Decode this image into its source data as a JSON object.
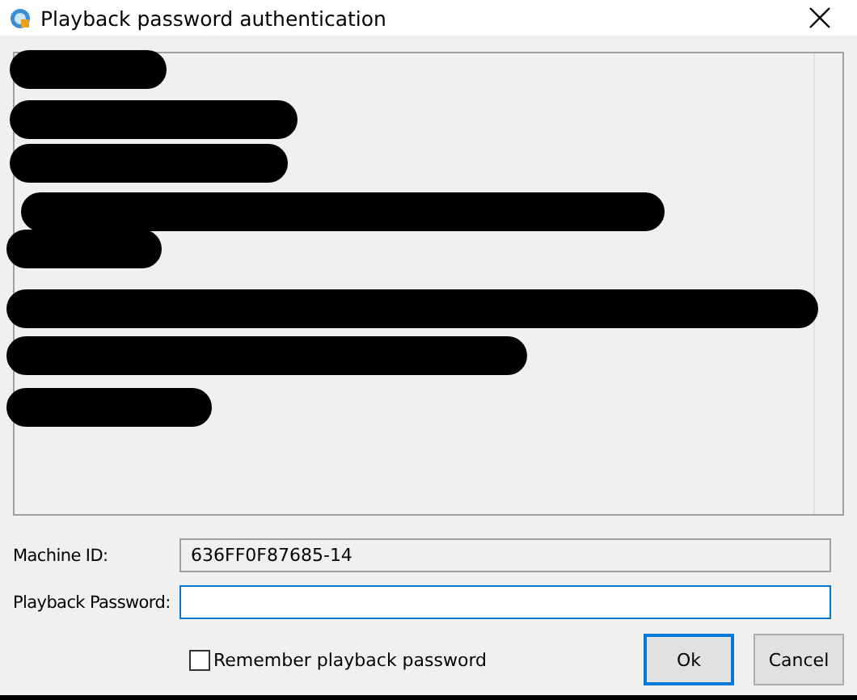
{
  "window": {
    "title": "Playback password authentication"
  },
  "message": {
    "redacted": true
  },
  "fields": [
    {
      "label": "Machine ID:",
      "value": "636FF0F87685-14",
      "disabled": true,
      "focused": false
    },
    {
      "label": "Playback Password:",
      "disabled": false,
      "focused": true
    }
  ],
  "remember": {
    "label": "Remember playback password",
    "checked": false
  },
  "buttons": [
    {
      "label": "Ok",
      "default": true
    },
    {
      "label": "Cancel",
      "default": false
    }
  ]
}
